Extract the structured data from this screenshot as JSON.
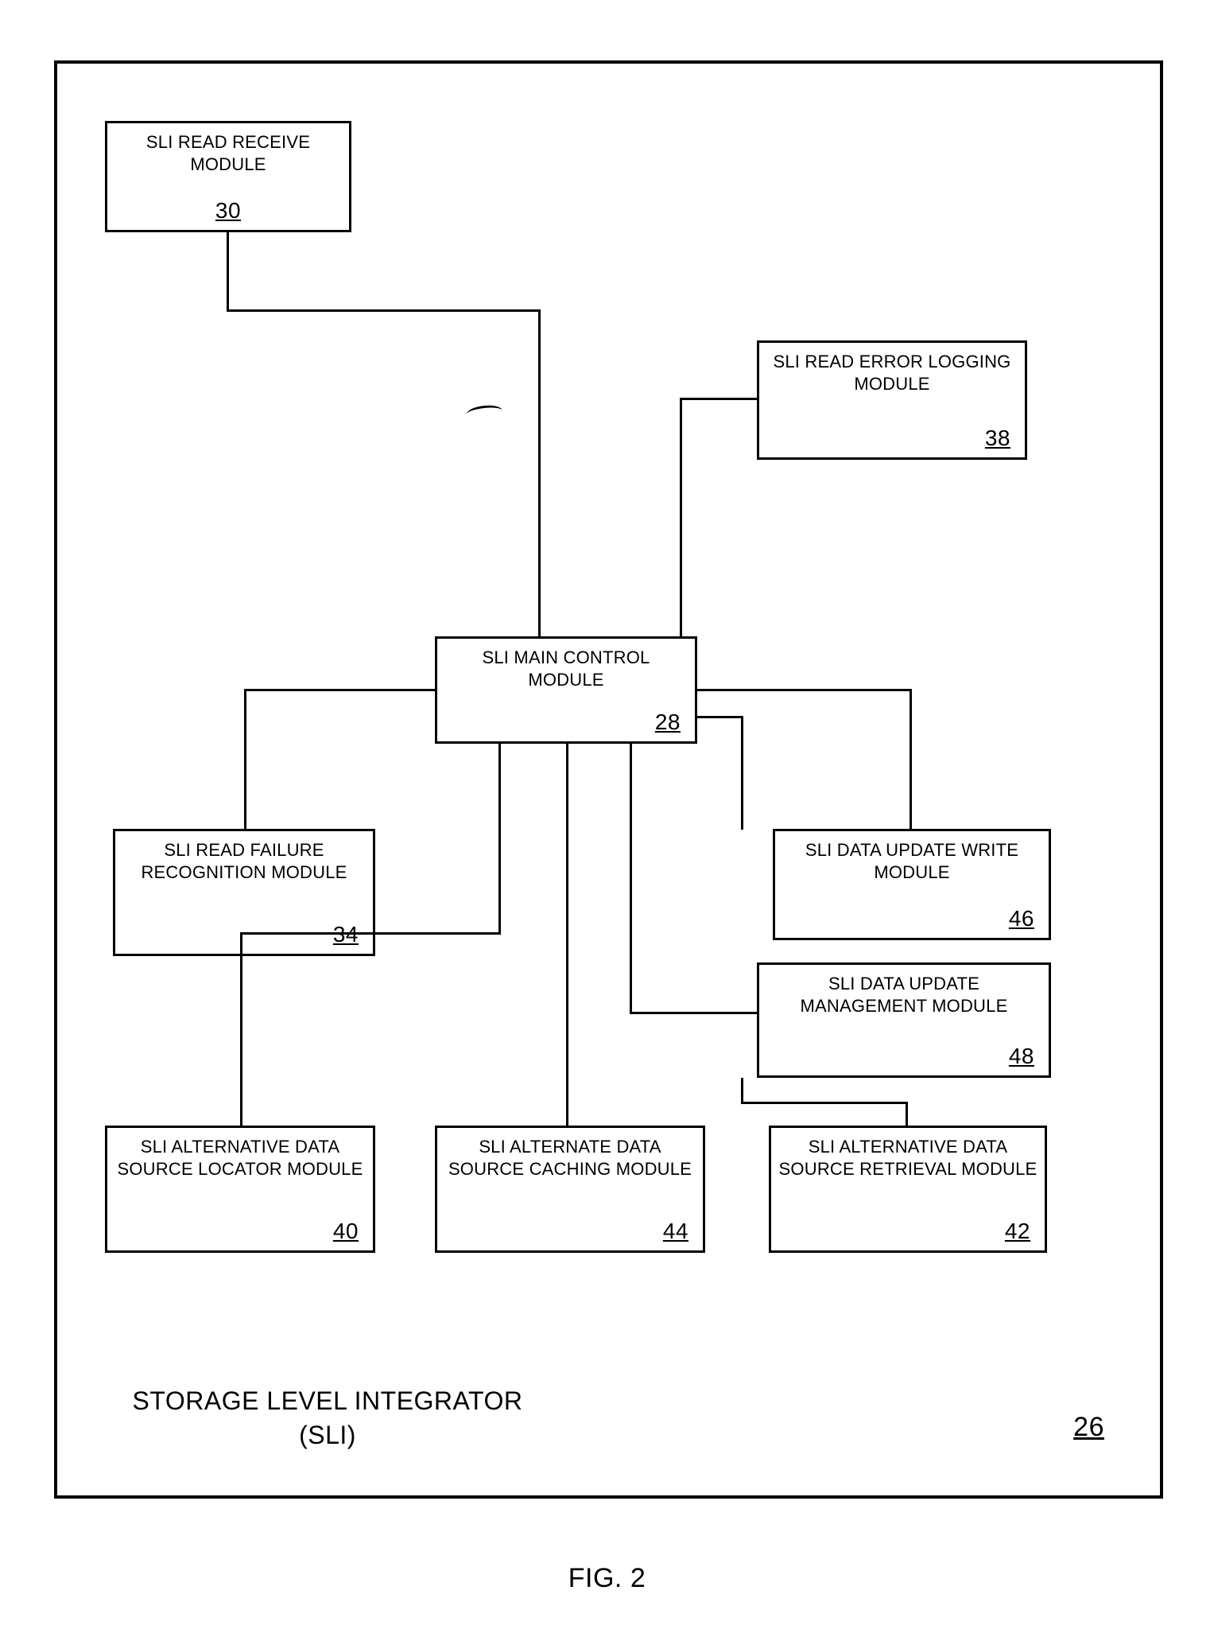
{
  "figure_caption": "FIG. 2",
  "container": {
    "title_line1": "STORAGE LEVEL INTEGRATOR",
    "title_line2": "(SLI)",
    "ref": "26"
  },
  "modules": {
    "read_receive": {
      "title": "SLI READ RECEIVE MODULE",
      "ref": "30"
    },
    "error_logging": {
      "title": "SLI READ ERROR LOGGING MODULE",
      "ref": "38"
    },
    "main_control": {
      "title": "SLI MAIN CONTROL MODULE",
      "ref": "28"
    },
    "read_failure": {
      "title": "SLI READ FAILURE RECOGNITION MODULE",
      "ref": "34"
    },
    "update_write": {
      "title": "SLI DATA UPDATE WRITE MODULE",
      "ref": "46"
    },
    "update_mgmt": {
      "title": "SLI DATA UPDATE MANAGEMENT MODULE",
      "ref": "48"
    },
    "alt_locator": {
      "title": "SLI ALTERNATIVE DATA SOURCE LOCATOR MODULE",
      "ref": "40"
    },
    "alt_caching": {
      "title": "SLI ALTERNATE DATA SOURCE CACHING MODULE",
      "ref": "44"
    },
    "alt_retrieval": {
      "title": "SLI ALTERNATIVE DATA SOURCE RETRIEVAL MODULE",
      "ref": "42"
    }
  }
}
